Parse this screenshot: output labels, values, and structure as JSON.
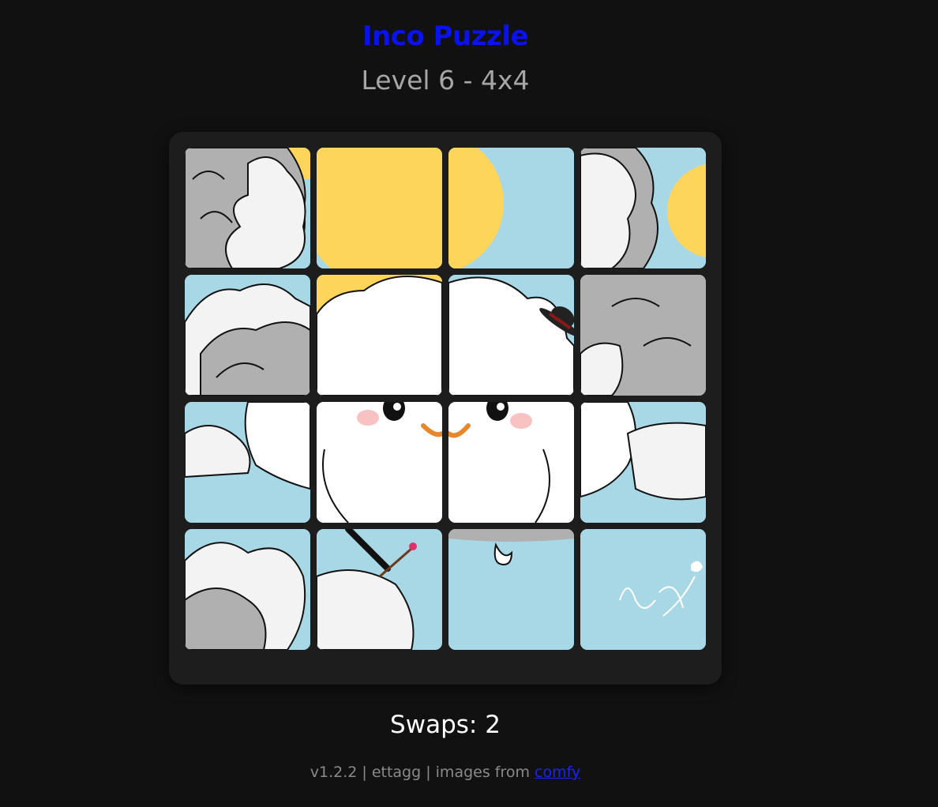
{
  "header": {
    "title": "Inco Puzzle",
    "level": "Level 6 - 4x4"
  },
  "puzzle": {
    "grid": "4x4",
    "tiles": [
      {
        "piece": "cloud top-left corner"
      },
      {
        "piece": "sun upper"
      },
      {
        "piece": "sun right edge"
      },
      {
        "piece": "cloud top-right corner with sun"
      },
      {
        "piece": "cloud left middle"
      },
      {
        "piece": "cloud head left"
      },
      {
        "piece": "cloud head right with hat"
      },
      {
        "piece": "cloud right middle"
      },
      {
        "piece": "cloud body left"
      },
      {
        "piece": "face left eye"
      },
      {
        "piece": "face right eye"
      },
      {
        "piece": "cloud body right"
      },
      {
        "piece": "cloud bottom-left"
      },
      {
        "piece": "arm with brush"
      },
      {
        "piece": "hand"
      },
      {
        "piece": "signature"
      }
    ]
  },
  "status": {
    "swaps_label": "Swaps: 2"
  },
  "footer": {
    "text": "v1.2.2 | ettagg | images from",
    "link_text": "comfy"
  },
  "colors": {
    "title": "#0a12ee",
    "background": "#111111",
    "board": "#1d1d1d",
    "sky": "#a8d8e6",
    "sun": "#fdd55a",
    "cloud_gray": "#b0b0b0",
    "cloud_white": "#ffffff",
    "blush": "#f7a8a8",
    "mouth": "#e8862c"
  }
}
